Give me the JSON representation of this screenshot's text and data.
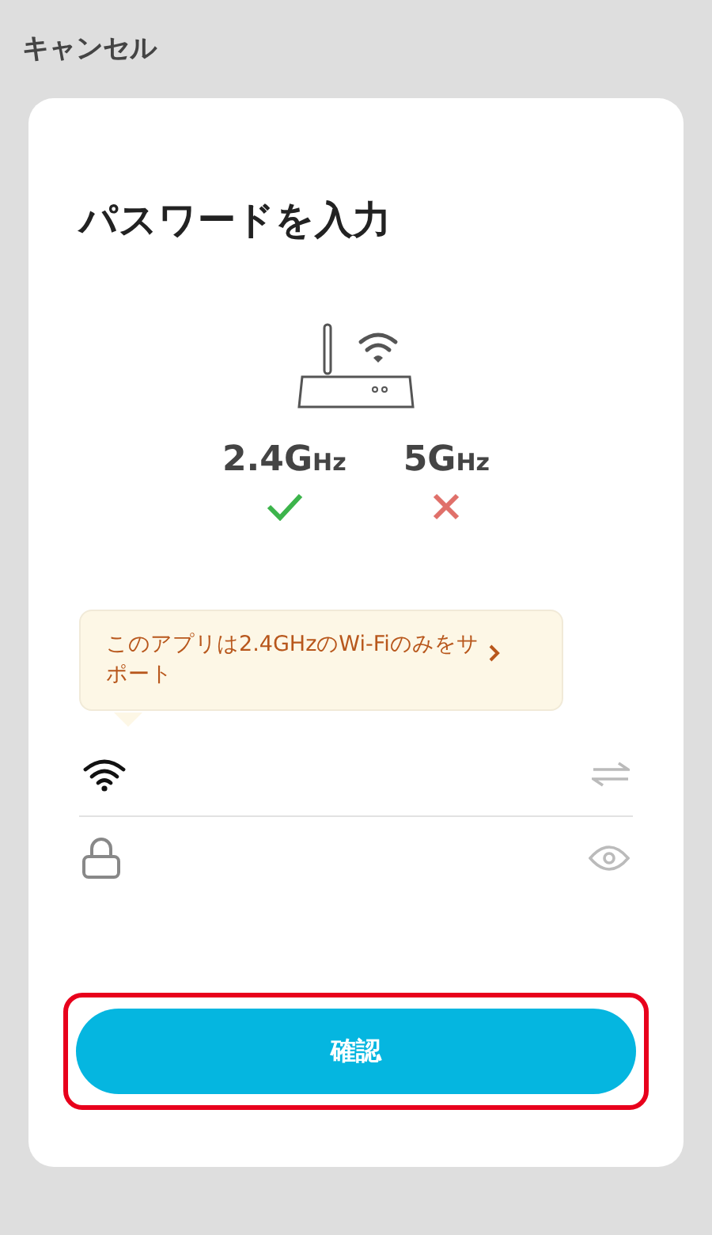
{
  "cancel_label": "キャンセル",
  "title": "パスワードを入力",
  "bands": [
    {
      "value": "2.4G",
      "unit": "Hz",
      "supported": true
    },
    {
      "value": "5G",
      "unit": "Hz",
      "supported": false
    }
  ],
  "notice": {
    "text": "このアプリは2.4GHzのWi-Fiのみをサポート"
  },
  "confirm_button": {
    "label": "確認",
    "highlighted": true
  }
}
